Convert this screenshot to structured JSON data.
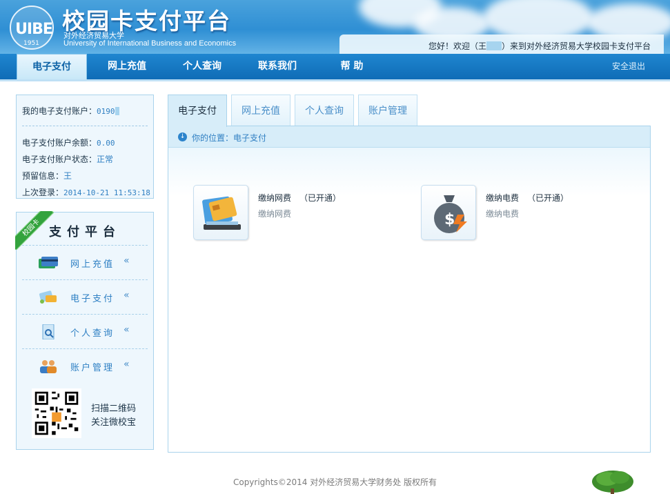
{
  "header": {
    "site_title": "校园卡支付平台",
    "logo_text": "UIBE",
    "logo_year": "1951",
    "university_cn": "对外经济贸易大学",
    "university_en": "University of International Business and Economics",
    "welcome_prefix": "您好！欢迎（王",
    "welcome_suffix": "）来到对外经济贸易大学校园卡支付平台"
  },
  "nav": {
    "items": [
      {
        "label": "电子支付"
      },
      {
        "label": "网上充值"
      },
      {
        "label": "个人查询"
      },
      {
        "label": "联系我们"
      },
      {
        "label": "帮 助"
      }
    ],
    "logout": "安全退出"
  },
  "account": {
    "account_label": "我的电子支付账户：",
    "account_value": "0190",
    "balance_label": "电子支付账户余额：",
    "balance_value": "0.00",
    "status_label": "电子支付账户状态：",
    "status_value": "正常",
    "reserved_label": "预留信息：",
    "reserved_value": "王",
    "last_login_label": "上次登录：",
    "last_login_value": "2014-10-21 11:53:18"
  },
  "platform": {
    "ribbon": "校园卡",
    "title": "支付平台",
    "menu": [
      {
        "label": "网上充值",
        "arrow": "«"
      },
      {
        "label": "电子支付",
        "arrow": "«"
      },
      {
        "label": "个人查询",
        "arrow": "«"
      },
      {
        "label": "账户管理",
        "arrow": "«"
      }
    ],
    "qr_line1": "扫描二维码",
    "qr_line2": "关注微校宝"
  },
  "tabs": [
    {
      "label": "电子支付"
    },
    {
      "label": "网上充值"
    },
    {
      "label": "个人查询"
    },
    {
      "label": "账户管理"
    }
  ],
  "location": {
    "icon": "down-arrow-circle-icon",
    "text": "你的位置：电子支付"
  },
  "services": [
    {
      "name": "缴纳网费",
      "status": "（已开通）",
      "desc": "缴纳网费",
      "icon": "network-card-icon"
    },
    {
      "name": "缴纳电费",
      "status": "（已开通）",
      "desc": "缴纳电费",
      "icon": "money-bag-electric-icon"
    }
  ],
  "footer": {
    "copyright": "Copyrights©2014 对外经济贸易大学财务处 版权所有"
  },
  "colors": {
    "nav_blue": "#1479c4",
    "panel_bg": "#eef7fd",
    "link_blue": "#2f7fc2",
    "ribbon_green": "#33a33d"
  }
}
